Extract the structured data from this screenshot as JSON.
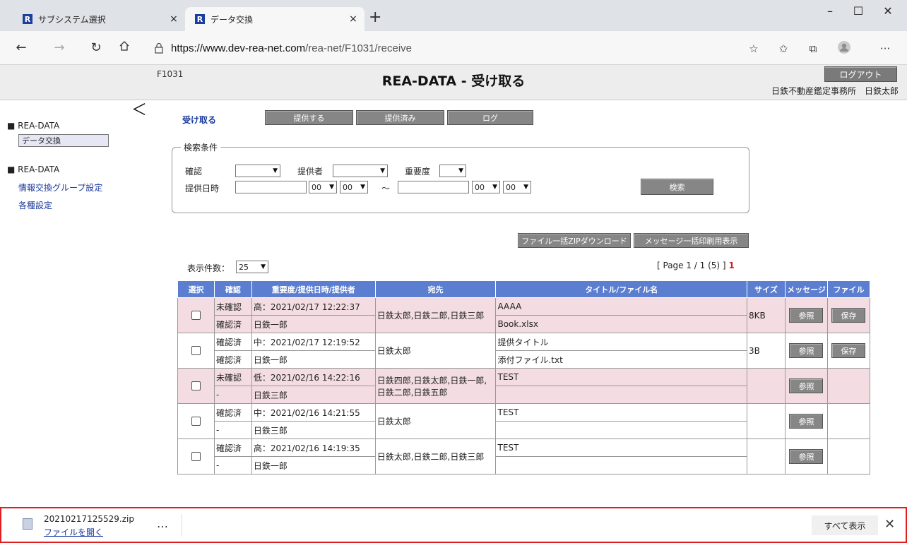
{
  "browser": {
    "tabs": [
      {
        "favicon": "R",
        "label": "サブシステム選択",
        "close": "×"
      },
      {
        "favicon": "R",
        "label": "データ交換",
        "close": "×"
      }
    ],
    "new_tab": "+",
    "window_controls": {
      "minimize": "–",
      "maximize": "☐",
      "close": "✕"
    },
    "url_host": "https://www.dev-rea-net.com",
    "url_path": "/rea-net/F1031/receive",
    "nav_icons": [
      "back-icon",
      "forward-icon",
      "refresh-icon",
      "home-icon"
    ],
    "toolbar_icons": [
      "favorite-add-icon",
      "favorites-icon",
      "collections-icon",
      "profile-icon",
      "more-icon"
    ]
  },
  "header": {
    "screen_id": "F1031",
    "title": "REA-DATA - 受け取る",
    "logout_label": "ログアウト",
    "user_line": "日鉄不動産鑑定事務所　日鉄太郎"
  },
  "sidebar": {
    "collapse_glyph": "＜",
    "sections": [
      {
        "title": "■ REA-DATA",
        "items": [
          "データ交換"
        ]
      },
      {
        "title": "■ REA-DATA",
        "items": [
          "情報交換グループ設定",
          "各種設定"
        ]
      }
    ]
  },
  "subtabs": {
    "current": "受け取る",
    "buttons": [
      "提供する",
      "提供済み",
      "ログ"
    ]
  },
  "search": {
    "legend": "検索条件",
    "confirm_label": "確認",
    "provider_label": "提供者",
    "priority_label": "重要度",
    "date_label": "提供日時",
    "hour1": "00",
    "min1": "00",
    "tilde": "～",
    "hour2": "00",
    "min2": "00",
    "search_button": "検索"
  },
  "actions": {
    "zip_download": "ファイル一括ZIPダウンロード",
    "print_messages": "メッセージ一括印刷用表示"
  },
  "paging": {
    "page_size_label": "表示件数：",
    "page_size": "25",
    "page_info": "[ Page 1 / 1 (5) ]",
    "current_page": "1"
  },
  "table": {
    "headers": [
      "選択",
      "確認",
      "重要度/提供日時/提供者",
      "宛先",
      "タイトル/ファイル名",
      "サイズ",
      "メッセージ",
      "ファイル"
    ],
    "view_label": "参照",
    "save_label": "保存",
    "rows": [
      {
        "confirm1": "未確認",
        "confirm2": "確認済",
        "prio_date": "高：2021/02/17 12:22:37",
        "provider": "日鉄一郎",
        "dest": "日鉄太郎,日鉄二郎,日鉄三郎",
        "title": "AAAA",
        "file": "Book.xlsx",
        "size": "8KB",
        "has_file": true,
        "highlight": true
      },
      {
        "confirm1": "確認済",
        "confirm2": "確認済",
        "prio_date": "中：2021/02/17 12:19:52",
        "provider": "日鉄一郎",
        "dest": "日鉄太郎",
        "title": "提供タイトル",
        "file": "添付ファイル.txt",
        "size": "3B",
        "has_file": true,
        "highlight": false
      },
      {
        "confirm1": "未確認",
        "confirm2": "-",
        "prio_date": "低：2021/02/16 14:22:16",
        "provider": "日鉄三郎",
        "dest": "日鉄四郎,日鉄太郎,日鉄一郎,日鉄二郎,日鉄五郎",
        "title": "TEST",
        "file": "",
        "size": "",
        "has_file": false,
        "highlight": true
      },
      {
        "confirm1": "確認済",
        "confirm2": "-",
        "prio_date": "中：2021/02/16 14:21:55",
        "provider": "日鉄三郎",
        "dest": "日鉄太郎",
        "title": "TEST",
        "file": "",
        "size": "",
        "has_file": false,
        "highlight": false
      },
      {
        "confirm1": "確認済",
        "confirm2": "-",
        "prio_date": "高：2021/02/16 14:19:35",
        "provider": "日鉄一郎",
        "dest": "日鉄太郎,日鉄二郎,日鉄三郎",
        "title": "TEST",
        "file": "",
        "size": "",
        "has_file": false,
        "highlight": false
      }
    ]
  },
  "download": {
    "filename": "20210217125529.zip",
    "open_label": "ファイルを開く",
    "more": "…",
    "show_all": "すべて表示",
    "close": "✕"
  }
}
